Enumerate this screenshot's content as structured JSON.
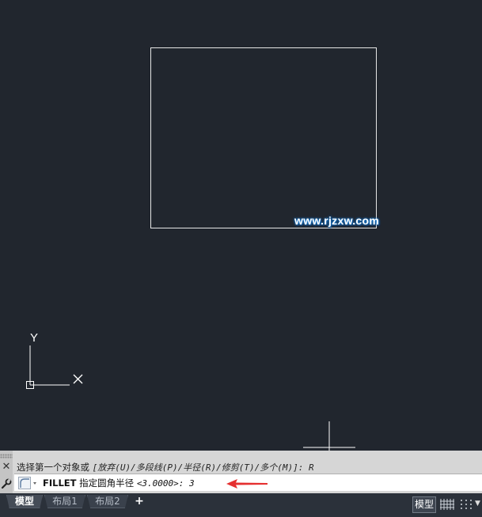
{
  "drawing": {
    "watermark": "www.rjzxw.com",
    "ucs": {
      "y_label": "Y",
      "x_label": "X"
    }
  },
  "command": {
    "history_prefix": "选择第一个对象或 ",
    "history_options": "[放弃(U)/多段线(P)/半径(R)/修剪(T)/多个(M)]: R",
    "command_name": "FILLET",
    "prompt": " 指定圆角半径 ",
    "default_value": "<3.0000>: ",
    "input": "3"
  },
  "layout_tabs": [
    {
      "label": "模型",
      "active": true
    },
    {
      "label": "布局1",
      "active": false
    },
    {
      "label": "布局2",
      "active": false
    }
  ],
  "add_tab": "+",
  "status_bar": {
    "model_button": "模型"
  },
  "colors": {
    "canvas_background": "#21262e",
    "annotation_arrow": "#e53030",
    "watermark_glow": "#1a7fd6"
  }
}
